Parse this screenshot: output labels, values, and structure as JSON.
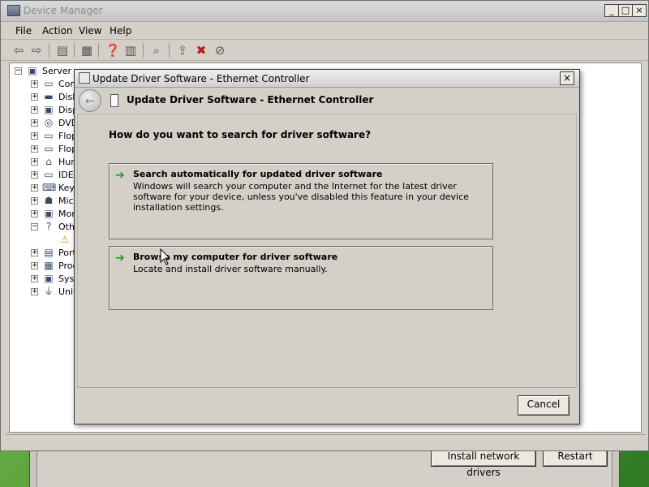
{
  "bg_window": {
    "buttons": [
      "Install network drivers",
      "Restart"
    ]
  },
  "device_manager": {
    "title": "Device Manager",
    "window_controls": [
      "_",
      "□",
      "×"
    ],
    "menu": [
      "File",
      "Action",
      "View",
      "Help"
    ],
    "toolbar_icons": [
      "back-arrow-icon",
      "forward-arrow-icon",
      "console-tree-icon",
      "properties-icon",
      "help-icon",
      "action-pane-icon",
      "scan-hardware-icon",
      "update-driver-icon",
      "uninstall-icon",
      "disable-icon"
    ],
    "tree": {
      "root": "Server",
      "items": [
        {
          "label": "Com",
          "expander": "+"
        },
        {
          "label": "Disk",
          "expander": "+"
        },
        {
          "label": "Disp",
          "expander": "+"
        },
        {
          "label": "DVD",
          "expander": "+"
        },
        {
          "label": "Flop",
          "expander": "+"
        },
        {
          "label": "Flop",
          "expander": "+"
        },
        {
          "label": "Hum",
          "expander": "+"
        },
        {
          "label": "IDE",
          "expander": "+"
        },
        {
          "label": "Key",
          "expander": "+"
        },
        {
          "label": "Mice",
          "expander": "+"
        },
        {
          "label": "Mon",
          "expander": "+"
        },
        {
          "label": "Oth",
          "expander": "−"
        },
        {
          "label": "",
          "expander": ""
        },
        {
          "label": "Port",
          "expander": "+"
        },
        {
          "label": "Proc",
          "expander": "+"
        },
        {
          "label": "Syst",
          "expander": "+"
        },
        {
          "label": "Univ",
          "expander": "+"
        }
      ]
    }
  },
  "dialog": {
    "title": "Update Driver Software - Ethernet Controller",
    "close_label": "×",
    "back_label": "←",
    "header_title": "Update Driver Software - Ethernet Controller",
    "question": "How do you want to search for driver software?",
    "options": [
      {
        "arrow": "➔",
        "title": "Search automatically for updated driver software",
        "description": "Windows will search your computer and the Internet for the latest driver software for your device, unless you've disabled this feature in your device installation settings."
      },
      {
        "arrow": "➔",
        "title": "Browse my computer for driver software",
        "description": "Locate and install driver software manually."
      }
    ],
    "cancel_label": "Cancel"
  }
}
